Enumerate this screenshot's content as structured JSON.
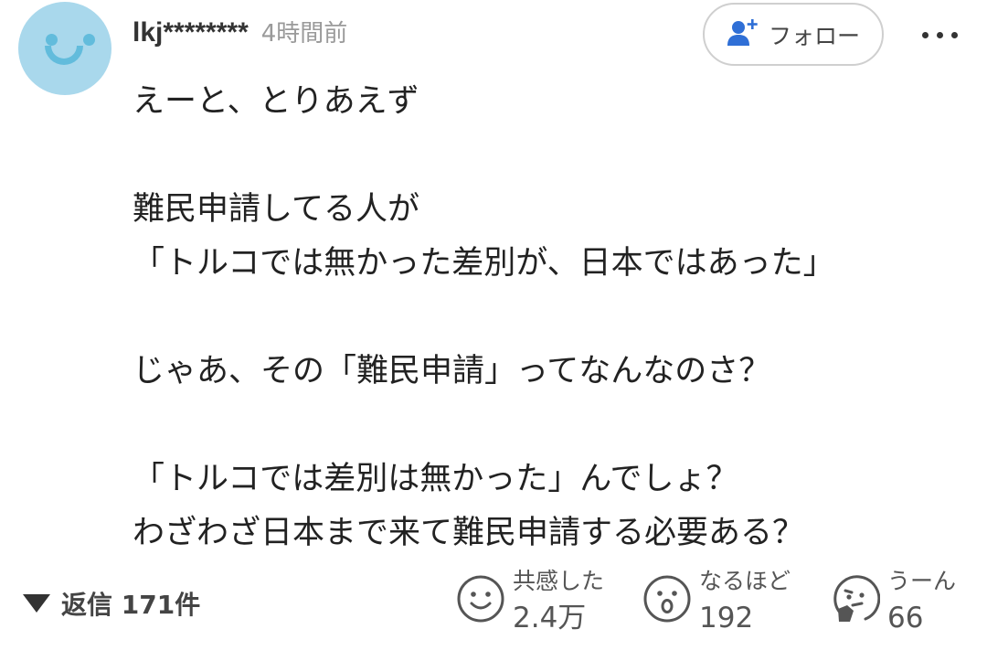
{
  "comment": {
    "username": "lkj********",
    "timestamp": "4時間前",
    "follow_label": "フォロー",
    "body_lines": [
      "えーと、とりあえず",
      "",
      "難民申請してる人が",
      "「トルコでは無かった差別が、日本ではあった」",
      "",
      "じゃあ、その「難民申請」ってなんなのさ？",
      "",
      "「トルコでは差別は無かった」んでしょ？",
      "わざわざ日本まで来て難民申請する必要ある？"
    ],
    "replies_label": "返信 171件",
    "reactions": [
      {
        "label": "共感した",
        "count": "2.4万",
        "icon": "smile-face-icon"
      },
      {
        "label": "なるほど",
        "count": "192",
        "icon": "surprised-face-icon"
      },
      {
        "label": "うーん",
        "count": "66",
        "icon": "thinking-face-icon"
      }
    ]
  },
  "colors": {
    "avatar_bg": "#a9d8ec",
    "avatar_face": "#62bcdc",
    "follow_icon": "#2f6fd6",
    "text": "#222222",
    "muted": "#9a9a9a"
  }
}
